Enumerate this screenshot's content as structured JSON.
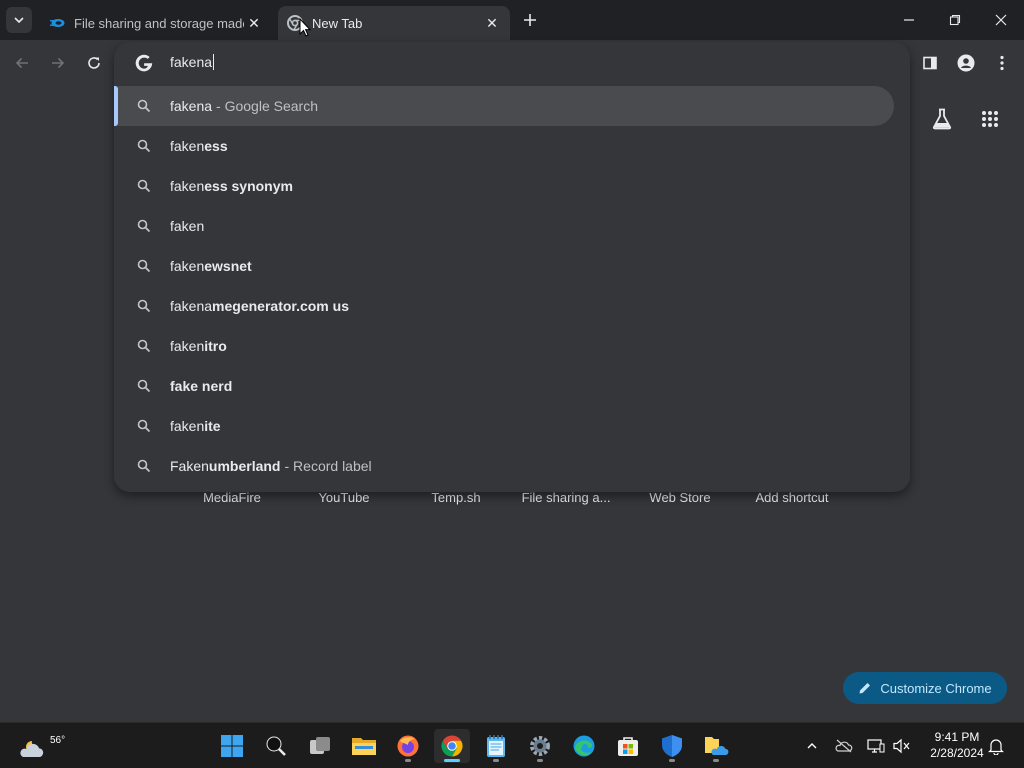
{
  "tabs": [
    {
      "title": "File sharing and storage made",
      "active": false
    },
    {
      "title": "New Tab",
      "active": true
    }
  ],
  "omnibox": {
    "typed": "fakena",
    "suggestions": [
      {
        "prefix": "fakena",
        "bold": "",
        "description": "- Google Search",
        "selected": true
      },
      {
        "prefix": "faken",
        "bold": "ess",
        "description": ""
      },
      {
        "prefix": "faken",
        "bold": "ess synonym",
        "description": ""
      },
      {
        "prefix": "faken",
        "bold": "",
        "description": ""
      },
      {
        "prefix": "faken",
        "bold": "ewsnet",
        "description": ""
      },
      {
        "prefix": "fakena",
        "bold": "megenerator.com us",
        "description": ""
      },
      {
        "prefix": "faken",
        "bold": "itro",
        "description": ""
      },
      {
        "prefix": "",
        "bold": "fake nerd",
        "description": ""
      },
      {
        "prefix": "faken",
        "bold": "ite",
        "description": ""
      },
      {
        "prefix": "Faken",
        "bold": "umberland",
        "description": "- Record label"
      }
    ]
  },
  "shortcuts": [
    "MediaFire",
    "YouTube",
    "Temp.sh",
    "File sharing a...",
    "Web Store",
    "Add shortcut"
  ],
  "customize_label": "Customize Chrome",
  "taskbar": {
    "weather_temp": "56°",
    "apps": [
      "start",
      "search",
      "task-view",
      "file-explorer",
      "firefox",
      "chrome",
      "notepad",
      "settings",
      "edge",
      "microsoft-store",
      "defender",
      "onedrive-folder"
    ],
    "time": "9:41 PM",
    "date": "2/28/2024"
  },
  "colors": {
    "frame": "#202124",
    "toolbar": "#35363a",
    "accent_blue": "#a8c7fa",
    "customize_bg": "#0b5a86",
    "taskbar_active": "#60cdff"
  }
}
